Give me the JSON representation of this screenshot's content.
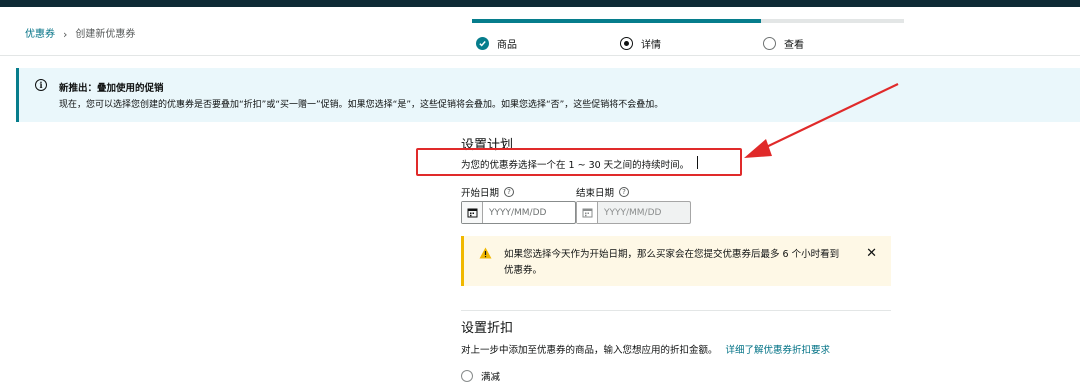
{
  "breadcrumb": {
    "root": "优惠券",
    "separator": "›",
    "current": "创建新优惠券"
  },
  "stepper": {
    "progress": 0.67,
    "steps": [
      {
        "label": "商品",
        "state": "done"
      },
      {
        "label": "详情",
        "state": "current"
      },
      {
        "label": "查看",
        "state": "todo"
      }
    ]
  },
  "notice": {
    "icon": "info-icon",
    "title": "新推出：叠加使用的促销",
    "body": "现在，您可以选择您创建的优惠券是否要叠加“折扣”或“买一赠一”促销。如果您选择“是”，这些促销将会叠加。如果您选择“否”，这些促销将不会叠加。"
  },
  "schedule": {
    "title": "设置计划",
    "hint": "为您的优惠券选择一个在 1 ~ 30 天之间的持续时间。",
    "start_label": "开始日期",
    "end_label": "结束日期",
    "start_placeholder": "YYYY/MM/DD",
    "end_placeholder": "YYYY/MM/DD"
  },
  "warning": {
    "icon": "warning-icon",
    "text": "如果您选择今天作为开始日期，那么买家会在您提交优惠券后最多 6 个小时看到优惠券。",
    "close": "✕"
  },
  "discount": {
    "title": "设置折扣",
    "desc": "对上一步中添加至优惠券的商品，输入您想应用的折扣金额。",
    "link": "详细了解优惠券折扣要求",
    "option": "满减"
  },
  "colors": {
    "accent": "#067d8c",
    "annotation": "#e02a2a",
    "warning": "#f0b800"
  }
}
